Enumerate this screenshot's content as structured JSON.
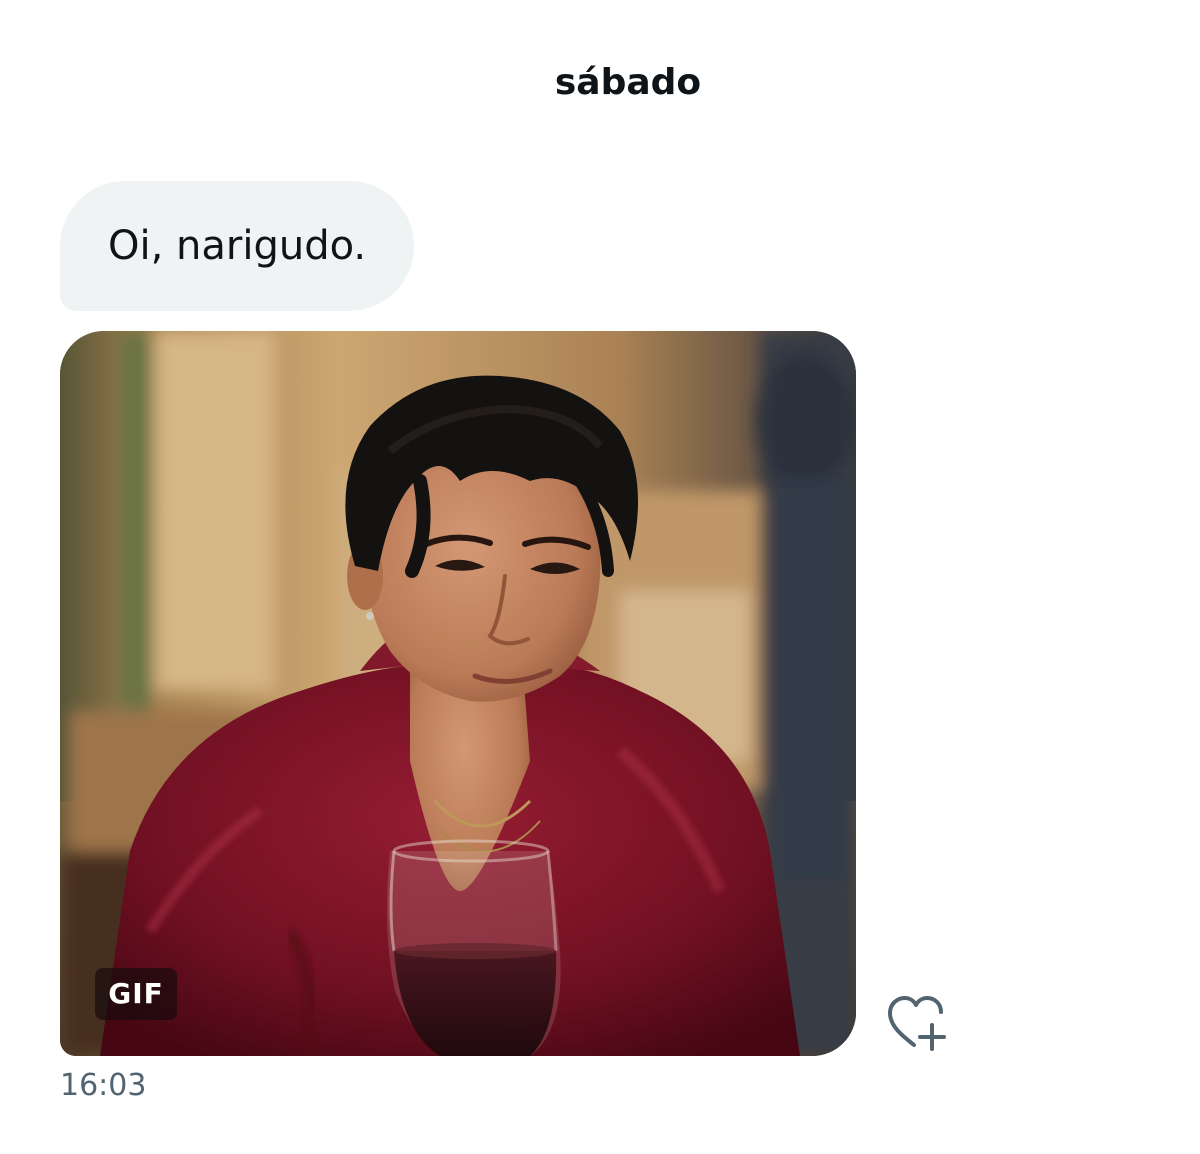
{
  "conversation": {
    "day_header": "sábado",
    "messages": [
      {
        "type": "text",
        "text": "Oi, narigudo."
      },
      {
        "type": "gif",
        "badge": "GIF",
        "icon": "gif-image"
      }
    ],
    "timestamp": "16:03",
    "reaction_icon": "heart-plus-icon"
  },
  "colors": {
    "bubble_background": "#eff3f4",
    "text_primary": "#0f1419",
    "text_secondary": "#536471"
  }
}
